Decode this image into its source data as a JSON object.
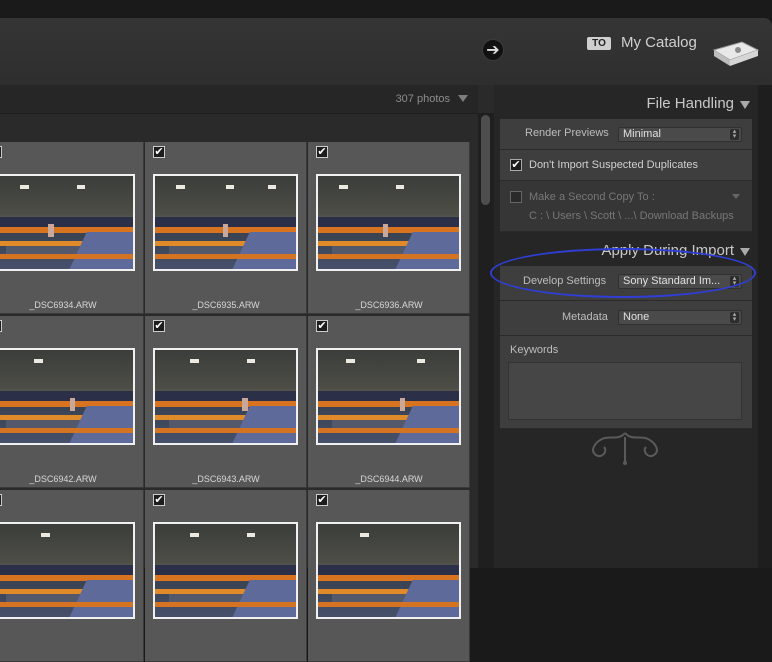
{
  "header": {
    "arrow_symbol": "➔",
    "to_badge": "TO",
    "catalog_name": "My Catalog"
  },
  "grid": {
    "count_label": "307 photos",
    "items": [
      {
        "filename": "_DSC6934.ARW",
        "checked": true
      },
      {
        "filename": "_DSC6935.ARW",
        "checked": true
      },
      {
        "filename": "_DSC6936.ARW",
        "checked": true
      },
      {
        "filename": "_DSC6942.ARW",
        "checked": true
      },
      {
        "filename": "_DSC6943.ARW",
        "checked": true
      },
      {
        "filename": "_DSC6944.ARW",
        "checked": true
      },
      {
        "filename": "",
        "checked": true
      },
      {
        "filename": "",
        "checked": true
      },
      {
        "filename": "",
        "checked": true
      }
    ],
    "check_symbol": "✔"
  },
  "file_handling": {
    "title": "File Handling",
    "render_previews_label": "Render Previews",
    "render_previews_value": "Minimal",
    "dont_import_dupes_label": "Don't Import Suspected Duplicates",
    "dont_import_dupes_checked": true,
    "second_copy_label": "Make a Second Copy To :",
    "second_copy_path": "C : \\ Users \\ Scott \\ ...\\ Download Backups",
    "second_copy_checked": false
  },
  "apply_during_import": {
    "title": "Apply During Import",
    "develop_settings_label": "Develop Settings",
    "develop_settings_value": "Sony Standard Im...",
    "metadata_label": "Metadata",
    "metadata_value": "None",
    "keywords_label": "Keywords"
  },
  "colors": {
    "annotation": "#2f3fd6"
  }
}
